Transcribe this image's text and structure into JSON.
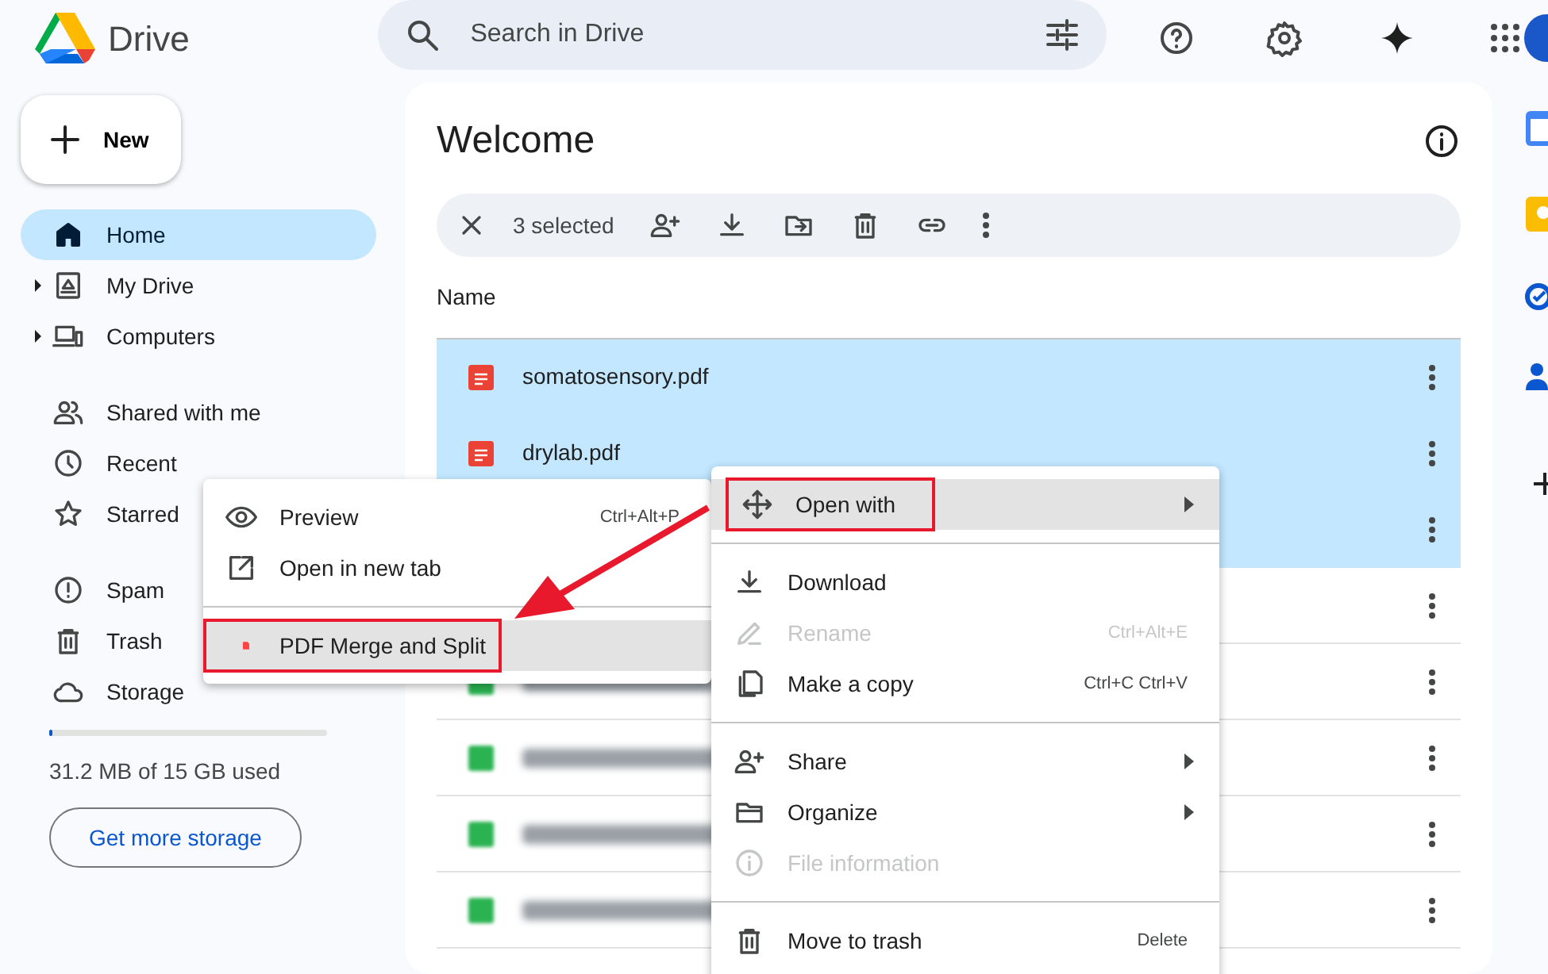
{
  "app": {
    "title": "Drive"
  },
  "search": {
    "placeholder": "Search in Drive"
  },
  "new_button": {
    "label": "New"
  },
  "sidebar": {
    "groups": [
      [
        {
          "label": "Home",
          "selected": true
        },
        {
          "label": "My Drive",
          "selected": false,
          "expanded": false
        },
        {
          "label": "Computers",
          "selected": false,
          "expanded": false
        }
      ],
      [
        {
          "label": "Shared with me",
          "selected": false
        },
        {
          "label": "Recent",
          "selected": false
        },
        {
          "label": "Starred",
          "selected": false
        }
      ],
      [
        {
          "label": "Spam",
          "selected": false
        },
        {
          "label": "Trash",
          "selected": false
        },
        {
          "label": "Storage",
          "selected": false
        }
      ]
    ]
  },
  "storage": {
    "level": 0.01,
    "usage": "31.2 MB of 15 GB used",
    "button": "Get more storage"
  },
  "page_title": "Welcome",
  "selection_bar": {
    "count": "3 selected"
  },
  "file_list": {
    "column": "Name",
    "rows": [
      {
        "name": "somatosensory.pdf",
        "kind": "pdf",
        "selected": true
      },
      {
        "name": "drylab.pdf",
        "kind": "pdf",
        "selected": true
      },
      {
        "kind": "hidden",
        "selected": true
      },
      {
        "kind": "hidden",
        "selected": false
      },
      {
        "kind": "sheet",
        "selected": false,
        "blurred": true
      },
      {
        "kind": "sheet",
        "selected": false,
        "blurred": true
      },
      {
        "kind": "sheet",
        "selected": false,
        "blurred": true
      },
      {
        "kind": "sheet",
        "selected": false,
        "blurred": true
      }
    ]
  },
  "context_menu": {
    "sections": [
      [
        {
          "label": "Open with",
          "submenu": true,
          "disabled": false,
          "hovered": true,
          "annotated": true
        }
      ],
      [
        {
          "label": "Download",
          "disabled": false
        },
        {
          "label": "Rename",
          "shortcut": "Ctrl+Alt+E",
          "disabled": true
        },
        {
          "label": "Make a copy",
          "shortcut": "Ctrl+C Ctrl+V",
          "disabled": false
        }
      ],
      [
        {
          "label": "Share",
          "submenu": true,
          "disabled": false
        },
        {
          "label": "Organize",
          "submenu": true,
          "disabled": false
        },
        {
          "label": "File information",
          "disabled": true
        }
      ],
      [
        {
          "label": "Move to trash",
          "shortcut": "Delete",
          "disabled": false
        }
      ]
    ]
  },
  "submenu": {
    "sections": [
      [
        {
          "label": "Preview",
          "shortcut": "Ctrl+Alt+P",
          "hovered": false
        },
        {
          "label": "Open in new tab",
          "hovered": false
        }
      ],
      [
        {
          "label": "PDF Merge and Split",
          "hovered": true,
          "annotated": true
        }
      ]
    ]
  },
  "annotation_arrow": true
}
